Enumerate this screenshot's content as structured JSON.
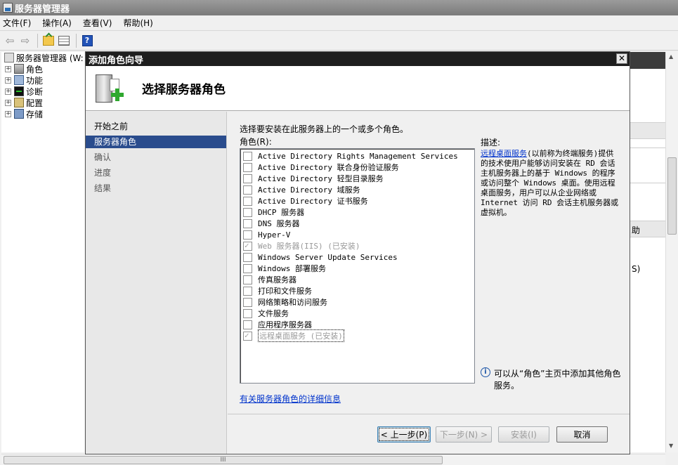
{
  "app": {
    "title": "服务器管理器"
  },
  "menu": [
    "文件(F)",
    "操作(A)",
    "查看(V)",
    "帮助(H)"
  ],
  "toolbar": {
    "help_glyph": "?"
  },
  "tree": {
    "root": "服务器管理器 (W:",
    "items": [
      "角色",
      "功能",
      "诊断",
      "配置",
      "存储"
    ]
  },
  "background_panel": {
    "row1_text": "助",
    "row2_text": "S)"
  },
  "dialog": {
    "title": "添加角色向导",
    "heading": "选择服务器角色",
    "nav": [
      "开始之前",
      "服务器角色",
      "确认",
      "进度",
      "结果"
    ],
    "active_nav_index": 1,
    "instruction": "选择要安装在此服务器上的一个或多个角色。",
    "roles_label": "角色(R):",
    "roles": [
      {
        "label": "Active Directory Rights Management Services",
        "checked": false,
        "disabled": false
      },
      {
        "label": "Active Directory 联合身份验证服务",
        "checked": false,
        "disabled": false
      },
      {
        "label": "Active Directory 轻型目录服务",
        "checked": false,
        "disabled": false
      },
      {
        "label": "Active Directory 域服务",
        "checked": false,
        "disabled": false
      },
      {
        "label": "Active Directory 证书服务",
        "checked": false,
        "disabled": false
      },
      {
        "label": "DHCP 服务器",
        "checked": false,
        "disabled": false
      },
      {
        "label": "DNS 服务器",
        "checked": false,
        "disabled": false
      },
      {
        "label": "Hyper-V",
        "checked": false,
        "disabled": false
      },
      {
        "label": "Web 服务器(IIS)  (已安装)",
        "checked": true,
        "disabled": true
      },
      {
        "label": "Windows Server Update Services",
        "checked": false,
        "disabled": false
      },
      {
        "label": "Windows 部署服务",
        "checked": false,
        "disabled": false
      },
      {
        "label": "传真服务器",
        "checked": false,
        "disabled": false
      },
      {
        "label": "打印和文件服务",
        "checked": false,
        "disabled": false
      },
      {
        "label": "网络策略和访问服务",
        "checked": false,
        "disabled": false
      },
      {
        "label": "文件服务",
        "checked": false,
        "disabled": false
      },
      {
        "label": "应用程序服务器",
        "checked": false,
        "disabled": false
      },
      {
        "label": "远程桌面服务  (已安装)",
        "checked": true,
        "disabled": true,
        "selected": true
      }
    ],
    "description_title": "描述:",
    "description_link": "远程桌面服务",
    "description_text": "(以前称为终端服务)提供的技术使用户能够访问安装在 RD 会话主机服务器上的基于 Windows 的程序或访问整个 Windows 桌面。使用远程桌面服务，用户可以从企业网络或 Internet 访问 RD 会话主机服务器或虚拟机。",
    "info_text": "可以从“角色”主页中添加其他角色服务。",
    "more_info_link": "有关服务器角色的详细信息",
    "buttons": {
      "back": "< 上一步(P)",
      "next": "下一步(N) >",
      "install": "安装(I)",
      "cancel": "取消"
    }
  },
  "scrollbar": {
    "grip": "III"
  }
}
